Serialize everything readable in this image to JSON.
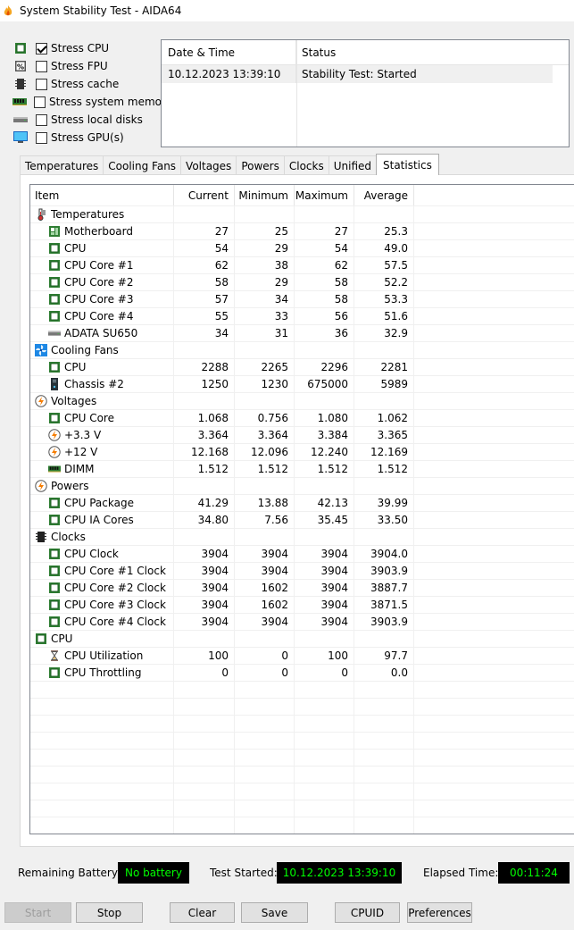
{
  "window": {
    "title": "System Stability Test - AIDA64"
  },
  "stress": [
    {
      "label": "Stress CPU",
      "checked": true,
      "icon": "cpu-chip-icon"
    },
    {
      "label": "Stress FPU",
      "checked": false,
      "icon": "fpu-chip-icon"
    },
    {
      "label": "Stress cache",
      "checked": false,
      "icon": "cache-chip-icon"
    },
    {
      "label": "Stress system memory",
      "checked": false,
      "icon": "memory-module-icon"
    },
    {
      "label": "Stress local disks",
      "checked": false,
      "icon": "disk-drive-icon"
    },
    {
      "label": "Stress GPU(s)",
      "checked": false,
      "icon": "monitor-icon"
    }
  ],
  "status_log": {
    "headers": [
      "Date & Time",
      "Status"
    ],
    "rows": [
      {
        "datetime": "10.12.2023 13:39:10",
        "status": "Stability Test: Started"
      }
    ]
  },
  "tabs": [
    "Temperatures",
    "Cooling Fans",
    "Voltages",
    "Powers",
    "Clocks",
    "Unified",
    "Statistics"
  ],
  "active_tab": "Statistics",
  "table": {
    "headers": {
      "item": "Item",
      "current": "Current",
      "minimum": "Minimum",
      "maximum": "Maximum",
      "average": "Average"
    },
    "rows": [
      {
        "type": "group",
        "label": "Temperatures",
        "icon": "thermometer-icon"
      },
      {
        "type": "item",
        "label": "Motherboard",
        "icon": "motherboard-icon",
        "cur": "27",
        "min": "25",
        "max": "27",
        "avg": "25.3"
      },
      {
        "type": "item",
        "label": "CPU",
        "icon": "cpu-chip-icon",
        "cur": "54",
        "min": "29",
        "max": "54",
        "avg": "49.0"
      },
      {
        "type": "item",
        "label": "CPU Core #1",
        "icon": "cpu-chip-icon",
        "cur": "62",
        "min": "38",
        "max": "62",
        "avg": "57.5"
      },
      {
        "type": "item",
        "label": "CPU Core #2",
        "icon": "cpu-chip-icon",
        "cur": "58",
        "min": "29",
        "max": "58",
        "avg": "52.2"
      },
      {
        "type": "item",
        "label": "CPU Core #3",
        "icon": "cpu-chip-icon",
        "cur": "57",
        "min": "34",
        "max": "58",
        "avg": "53.3"
      },
      {
        "type": "item",
        "label": "CPU Core #4",
        "icon": "cpu-chip-icon",
        "cur": "55",
        "min": "33",
        "max": "56",
        "avg": "51.6"
      },
      {
        "type": "item",
        "label": "ADATA SU650",
        "icon": "disk-drive-icon",
        "cur": "34",
        "min": "31",
        "max": "36",
        "avg": "32.9"
      },
      {
        "type": "group",
        "label": "Cooling Fans",
        "icon": "fan-icon"
      },
      {
        "type": "item",
        "label": "CPU",
        "icon": "cpu-chip-icon",
        "cur": "2288",
        "min": "2265",
        "max": "2296",
        "avg": "2281"
      },
      {
        "type": "item",
        "label": "Chassis #2",
        "icon": "chassis-icon",
        "cur": "1250",
        "min": "1230",
        "max": "675000",
        "avg": "5989"
      },
      {
        "type": "group",
        "label": "Voltages",
        "icon": "lightning-icon"
      },
      {
        "type": "item",
        "label": "CPU Core",
        "icon": "cpu-chip-icon",
        "cur": "1.068",
        "min": "0.756",
        "max": "1.080",
        "avg": "1.062"
      },
      {
        "type": "item",
        "label": "+3.3 V",
        "icon": "lightning-icon",
        "cur": "3.364",
        "min": "3.364",
        "max": "3.384",
        "avg": "3.365"
      },
      {
        "type": "item",
        "label": "+12 V",
        "icon": "lightning-icon",
        "cur": "12.168",
        "min": "12.096",
        "max": "12.240",
        "avg": "12.169"
      },
      {
        "type": "item",
        "label": "DIMM",
        "icon": "memory-module-icon",
        "cur": "1.512",
        "min": "1.512",
        "max": "1.512",
        "avg": "1.512"
      },
      {
        "type": "group",
        "label": "Powers",
        "icon": "lightning-icon"
      },
      {
        "type": "item",
        "label": "CPU Package",
        "icon": "cpu-chip-icon",
        "cur": "41.29",
        "min": "13.88",
        "max": "42.13",
        "avg": "39.99"
      },
      {
        "type": "item",
        "label": "CPU IA Cores",
        "icon": "cpu-chip-icon",
        "cur": "34.80",
        "min": "7.56",
        "max": "35.45",
        "avg": "33.50"
      },
      {
        "type": "group",
        "label": "Clocks",
        "icon": "clock-chip-icon"
      },
      {
        "type": "item",
        "label": "CPU Clock",
        "icon": "cpu-chip-icon",
        "cur": "3904",
        "min": "3904",
        "max": "3904",
        "avg": "3904.0"
      },
      {
        "type": "item",
        "label": "CPU Core #1 Clock",
        "icon": "cpu-chip-icon",
        "cur": "3904",
        "min": "3904",
        "max": "3904",
        "avg": "3903.9"
      },
      {
        "type": "item",
        "label": "CPU Core #2 Clock",
        "icon": "cpu-chip-icon",
        "cur": "3904",
        "min": "1602",
        "max": "3904",
        "avg": "3887.7"
      },
      {
        "type": "item",
        "label": "CPU Core #3 Clock",
        "icon": "cpu-chip-icon",
        "cur": "3904",
        "min": "1602",
        "max": "3904",
        "avg": "3871.5"
      },
      {
        "type": "item",
        "label": "CPU Core #4 Clock",
        "icon": "cpu-chip-icon",
        "cur": "3904",
        "min": "3904",
        "max": "3904",
        "avg": "3903.9"
      },
      {
        "type": "group",
        "label": "CPU",
        "icon": "cpu-chip-icon"
      },
      {
        "type": "item",
        "label": "CPU Utilization",
        "icon": "hourglass-icon",
        "cur": "100",
        "min": "0",
        "max": "100",
        "avg": "97.7"
      },
      {
        "type": "item",
        "label": "CPU Throttling",
        "icon": "cpu-chip-icon",
        "cur": "0",
        "min": "0",
        "max": "0",
        "avg": "0.0"
      }
    ]
  },
  "footer": {
    "remaining_battery_label": "Remaining Battery:",
    "remaining_battery_value": "No battery",
    "test_started_label": "Test Started:",
    "test_started_value": "10.12.2023 13:39:10",
    "elapsed_label": "Elapsed Time:",
    "elapsed_value": "00:11:24"
  },
  "buttons": {
    "start": "Start",
    "stop": "Stop",
    "clear": "Clear",
    "save": "Save",
    "cpuid": "CPUID",
    "preferences": "Preferences"
  },
  "colors": {
    "lcd_background": "#000000",
    "lcd_text": "#00ff00",
    "chip_green": "#2e7d32"
  }
}
